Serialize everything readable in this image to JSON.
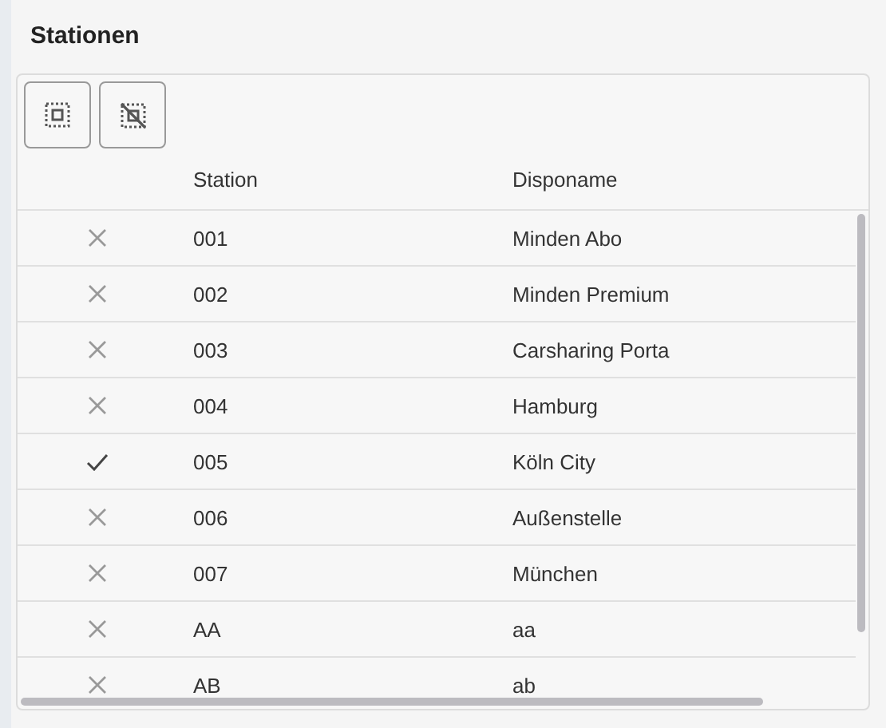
{
  "title": "Stationen",
  "toolbar": [
    {
      "kind": "select-all"
    },
    {
      "kind": "deselect-all"
    }
  ],
  "table": {
    "columns": [
      "Station",
      "Disponame"
    ],
    "rows": [
      {
        "checked": false,
        "station": "001",
        "disponame": "Minden Abo"
      },
      {
        "checked": false,
        "station": "002",
        "disponame": "Minden Premium"
      },
      {
        "checked": false,
        "station": "003",
        "disponame": "Carsharing Porta"
      },
      {
        "checked": false,
        "station": "004",
        "disponame": "Hamburg"
      },
      {
        "checked": true,
        "station": "005",
        "disponame": "Köln City"
      },
      {
        "checked": false,
        "station": "006",
        "disponame": "Außenstelle"
      },
      {
        "checked": false,
        "station": "007",
        "disponame": "München"
      },
      {
        "checked": false,
        "station": "AA",
        "disponame": "aa"
      },
      {
        "checked": false,
        "station": "AB",
        "disponame": "ab"
      }
    ]
  }
}
